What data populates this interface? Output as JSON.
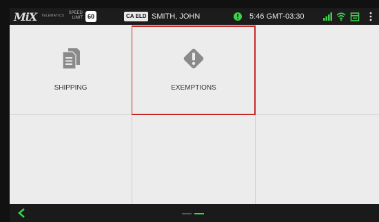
{
  "status_bar": {
    "logo": "MiX",
    "telematics_text": "TELEMATICS",
    "speed_limit_label": "SPEED LIMIT",
    "speed_limit_value": "60",
    "eld_badge": "CA ELD",
    "driver_name": "SMITH, JOHN",
    "time": "5:46 GMT-03:30",
    "icons": [
      "clock-alert-icon",
      "signal-icon",
      "wifi-icon",
      "calendar-icon",
      "menu-icon"
    ],
    "accent_color": "#3cd24a"
  },
  "tiles": [
    {
      "label": "SHIPPING",
      "icon": "document-copy-icon"
    },
    {
      "label": "EXEMPTIONS",
      "icon": "warning-diamond-icon",
      "selected": true
    },
    {
      "label": "",
      "icon": ""
    },
    {
      "label": "",
      "icon": ""
    },
    {
      "label": "",
      "icon": ""
    },
    {
      "label": "",
      "icon": ""
    }
  ],
  "colors": {
    "selection_border": "#c62828",
    "tile_background": "#ececec",
    "icon_gray": "#8a8a8a"
  },
  "bottom_bar": {
    "back_icon": "chevron-left-icon",
    "page_indicator_total": 2,
    "page_indicator_active": 2
  }
}
